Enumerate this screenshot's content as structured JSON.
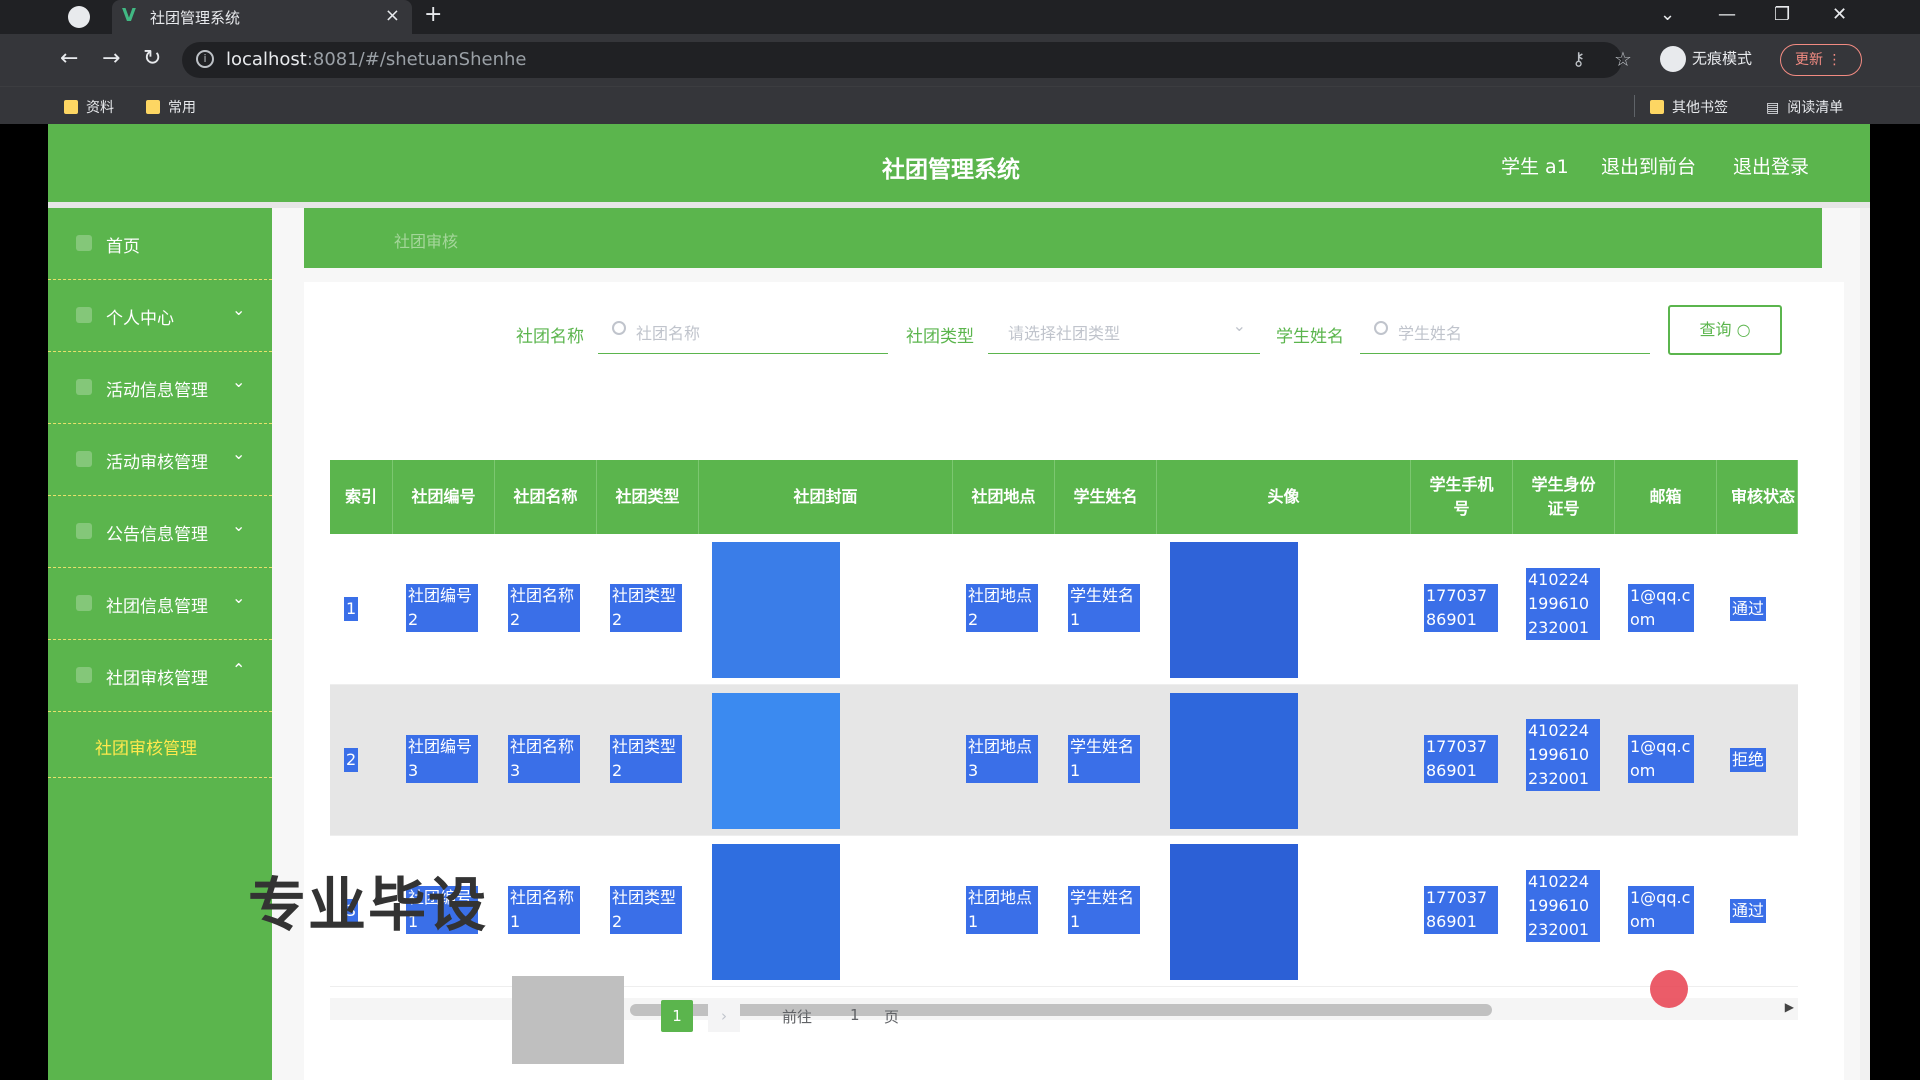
{
  "browser": {
    "tab_title": "社团管理系统",
    "tab_close": "×",
    "new_tab": "+",
    "url_host": "localhost",
    "url_rest": ":8081/#/shetuanShenhe",
    "incognito_label": "无痕模式",
    "update_label": "更新",
    "bookmarks": [
      "资料",
      "常用"
    ],
    "bookmarks_right": [
      "其他书签",
      "阅读清单"
    ]
  },
  "header": {
    "title": "社团管理系统",
    "user": "学生 a1",
    "to_front": "退出到前台",
    "logout": "退出登录"
  },
  "sidebar": {
    "items": [
      {
        "label": "首页",
        "icon": "home-icon"
      },
      {
        "label": "个人中心",
        "icon": "user-icon"
      },
      {
        "label": "活动信息管理",
        "icon": "list-icon"
      },
      {
        "label": "活动审核管理",
        "icon": "list-icon"
      },
      {
        "label": "公告信息管理",
        "icon": "bell-icon"
      },
      {
        "label": "社团信息管理",
        "icon": "gear-icon"
      },
      {
        "label": "社团审核管理",
        "icon": "check-icon"
      }
    ],
    "sub_item": "社团审核管理"
  },
  "breadcrumb": "社团审核",
  "search": {
    "name_label": "社团名称",
    "name_placeholder": "社团名称",
    "type_label": "社团类型",
    "type_placeholder": "请选择社团类型",
    "student_label": "学生姓名",
    "student_placeholder": "学生姓名",
    "query_button": "查询"
  },
  "table": {
    "columns": [
      "索引",
      "社团编号",
      "社团名称",
      "社团类型",
      "社团封面",
      "社团地点",
      "学生姓名",
      "头像",
      "学生手机号",
      "学生身份证号",
      "邮箱",
      "审核状态"
    ],
    "rows": [
      {
        "index": "1",
        "code": "社团编号2",
        "name": "社团名称2",
        "type": "社团类型2",
        "place": "社团地点2",
        "student": "学生姓名1",
        "phone": "17703786901",
        "idcard": "410224199610232001",
        "email": "1@qq.com",
        "status": "通过"
      },
      {
        "index": "2",
        "code": "社团编号3",
        "name": "社团名称3",
        "type": "社团类型2",
        "place": "社团地点3",
        "student": "学生姓名1",
        "phone": "17703786901",
        "idcard": "410224199610232001",
        "email": "1@qq.com",
        "status": "拒绝"
      },
      {
        "index": "3",
        "code": "社团编号1",
        "name": "社团名称1",
        "type": "社团类型2",
        "place": "社团地点1",
        "student": "学生姓名1",
        "phone": "17703786901",
        "idcard": "410224199610232001",
        "email": "1@qq.com",
        "status": "通过"
      }
    ]
  },
  "pager": {
    "current": "1",
    "goto": "前往",
    "page_input": "1",
    "page_suffix": "页"
  },
  "watermark": "专业毕设",
  "colors": {
    "primary": "#5bb54d",
    "highlight": "#3a6fe8",
    "submenu_active": "#ffe94d"
  }
}
